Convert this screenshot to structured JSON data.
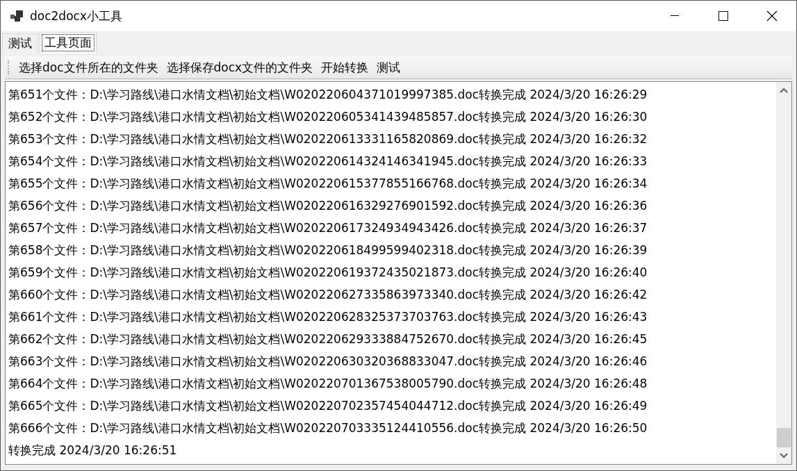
{
  "window": {
    "title": "doc2docx小工具"
  },
  "tabs": [
    {
      "label": "测试",
      "selected": false
    },
    {
      "label": "工具页面",
      "selected": true
    }
  ],
  "toolbar": [
    "选择doc文件所在的文件夹",
    "选择保存docx文件的文件夹",
    "开始转换",
    "测试"
  ],
  "log": [
    "第651个文件：D:\\学习路线\\港口水情文档\\初始文档\\W020220604371019997385.doc转换完成 2024/3/20 16:26:29",
    "第652个文件：D:\\学习路线\\港口水情文档\\初始文档\\W020220605341439485857.doc转换完成 2024/3/20 16:26:30",
    "第653个文件：D:\\学习路线\\港口水情文档\\初始文档\\W020220613331165820869.doc转换完成 2024/3/20 16:26:32",
    "第654个文件：D:\\学习路线\\港口水情文档\\初始文档\\W020220614324146341945.doc转换完成 2024/3/20 16:26:33",
    "第655个文件：D:\\学习路线\\港口水情文档\\初始文档\\W020220615377855166768.doc转换完成 2024/3/20 16:26:34",
    "第656个文件：D:\\学习路线\\港口水情文档\\初始文档\\W020220616329276901592.doc转换完成 2024/3/20 16:26:36",
    "第657个文件：D:\\学习路线\\港口水情文档\\初始文档\\W020220617324934943426.doc转换完成 2024/3/20 16:26:37",
    "第658个文件：D:\\学习路线\\港口水情文档\\初始文档\\W020220618499599402318.doc转换完成 2024/3/20 16:26:39",
    "第659个文件：D:\\学习路线\\港口水情文档\\初始文档\\W020220619372435021873.doc转换完成 2024/3/20 16:26:40",
    "第660个文件：D:\\学习路线\\港口水情文档\\初始文档\\W020220627335863973340.doc转换完成 2024/3/20 16:26:42",
    "第661个文件：D:\\学习路线\\港口水情文档\\初始文档\\W020220628325373703763.doc转换完成 2024/3/20 16:26:43",
    "第662个文件：D:\\学习路线\\港口水情文档\\初始文档\\W020220629333884752670.doc转换完成 2024/3/20 16:26:45",
    "第663个文件：D:\\学习路线\\港口水情文档\\初始文档\\W020220630320368833047.doc转换完成 2024/3/20 16:26:46",
    "第664个文件：D:\\学习路线\\港口水情文档\\初始文档\\W020220701367538005790.doc转换完成 2024/3/20 16:26:48",
    "第665个文件：D:\\学习路线\\港口水情文档\\初始文档\\W020220702357454044712.doc转换完成 2024/3/20 16:26:49",
    "第666个文件：D:\\学习路线\\港口水情文档\\初始文档\\W020220703335124410556.doc转换完成 2024/3/20 16:26:50",
    "转换完成 2024/3/20 16:26:51"
  ]
}
